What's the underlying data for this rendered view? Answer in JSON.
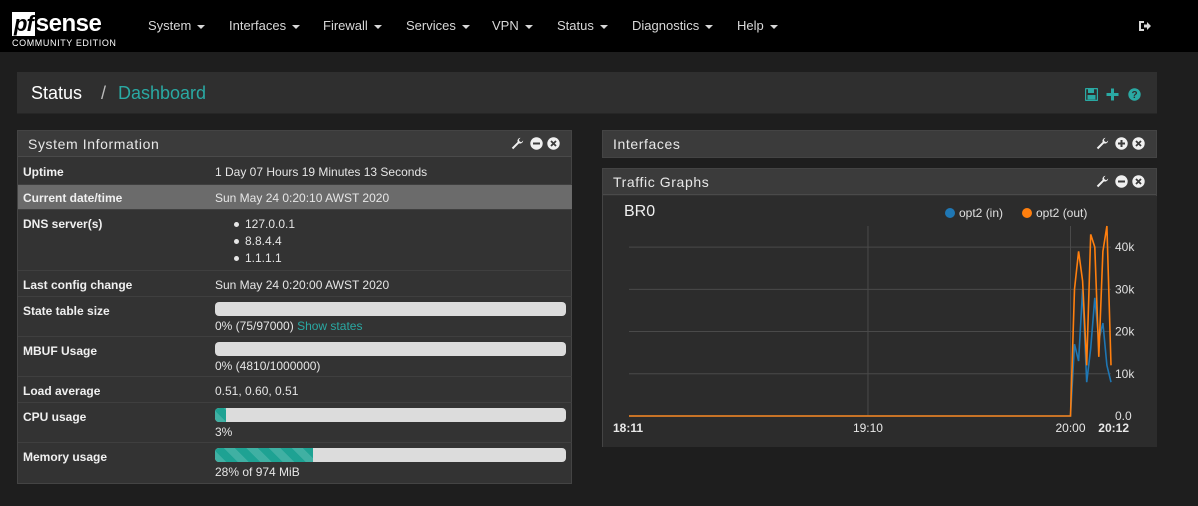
{
  "app": {
    "logo_main_pf": "pf",
    "logo_main_sense": "sense",
    "logo_sub": "COMMUNITY EDITION"
  },
  "nav": {
    "items": [
      {
        "label": "System"
      },
      {
        "label": "Interfaces"
      },
      {
        "label": "Firewall"
      },
      {
        "label": "Services"
      },
      {
        "label": "VPN"
      },
      {
        "label": "Status"
      },
      {
        "label": "Diagnostics"
      },
      {
        "label": "Help"
      }
    ],
    "logout_icon": "logout-icon"
  },
  "breadcrumb": {
    "parent": "Status",
    "separator": "/",
    "current": "Dashboard",
    "icons": [
      "save-icon",
      "plus-icon",
      "help-icon"
    ]
  },
  "colors": {
    "accent": "#2aa9a3",
    "bar_fill": "#1ea293",
    "series_in": "#1f77b4",
    "series_out": "#ff7f0e"
  },
  "system_info": {
    "title": "System Information",
    "rows": {
      "uptime": {
        "label": "Uptime",
        "value": "1 Day 07 Hours 19 Minutes 13 Seconds"
      },
      "datetime": {
        "label": "Current date/time",
        "value": "Sun May 24 0:20:10 AWST 2020"
      },
      "dns": {
        "label": "DNS server(s)",
        "values": [
          "127.0.0.1",
          "8.8.4.4",
          "1.1.1.1"
        ]
      },
      "last_config": {
        "label": "Last config change",
        "value": "Sun May 24 0:20:00 AWST 2020"
      },
      "state_table": {
        "label": "State table size",
        "text": "0% (75/97000)",
        "link": "Show states",
        "percent": 0
      },
      "mbuf": {
        "label": "MBUF Usage",
        "text": "0% (4810/1000000)",
        "percent": 0
      },
      "load": {
        "label": "Load average",
        "value": "0.51, 0.60, 0.51"
      },
      "cpu": {
        "label": "CPU usage",
        "text": "3%",
        "percent": 3
      },
      "memory": {
        "label": "Memory usage",
        "text": "28% of 974 MiB",
        "percent": 28
      }
    }
  },
  "interfaces_widget": {
    "title": "Interfaces"
  },
  "traffic_widget": {
    "title": "Traffic Graphs",
    "graph_title": "BR0",
    "legend": [
      "opt2 (in)",
      "opt2 (out)"
    ]
  },
  "chart_data": {
    "type": "line",
    "title": "BR0",
    "x_tick_labels": [
      "18:11",
      "19:10",
      "20:00",
      "20:12"
    ],
    "y_tick_labels": [
      "0.0",
      "10k",
      "20k",
      "30k",
      "40k"
    ],
    "ylim": [
      0,
      45000
    ],
    "grid": true,
    "legend_position": "top-right",
    "x_unit": "minutes since 18:11",
    "series": [
      {
        "name": "opt2 (in)",
        "color": "#1f77b4",
        "points": [
          [
            0,
            0
          ],
          [
            108,
            0
          ],
          [
            109,
            0
          ],
          [
            110,
            17000
          ],
          [
            111,
            13000
          ],
          [
            112,
            30000
          ],
          [
            113,
            8000
          ],
          [
            114,
            16000
          ],
          [
            115,
            28000
          ],
          [
            116,
            18000
          ],
          [
            117,
            22000
          ],
          [
            118,
            12000
          ],
          [
            119,
            8000
          ]
        ]
      },
      {
        "name": "opt2 (out)",
        "color": "#ff7f0e",
        "points": [
          [
            0,
            0
          ],
          [
            108,
            0
          ],
          [
            109,
            0
          ],
          [
            110,
            30000
          ],
          [
            111,
            39000
          ],
          [
            112,
            32000
          ],
          [
            113,
            12000
          ],
          [
            114,
            43000
          ],
          [
            115,
            40000
          ],
          [
            116,
            14000
          ],
          [
            117,
            39000
          ],
          [
            118,
            45000
          ],
          [
            119,
            12000
          ]
        ]
      }
    ]
  }
}
